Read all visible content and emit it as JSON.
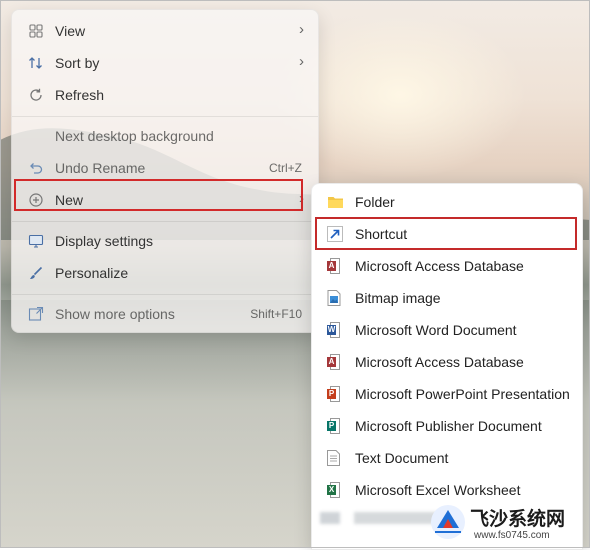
{
  "context_menu": {
    "items": [
      {
        "label": "View",
        "icon": "grid-icon",
        "submenu": true
      },
      {
        "label": "Sort by",
        "icon": "sort-icon",
        "submenu": true
      },
      {
        "label": "Refresh",
        "icon": "refresh-icon"
      },
      {
        "label": "Next desktop background",
        "icon": ""
      },
      {
        "label": "Undo Rename",
        "icon": "undo-icon",
        "shortcut": "Ctrl+Z"
      },
      {
        "label": "New",
        "icon": "plus-circle-icon",
        "submenu": true
      },
      {
        "label": "Display settings",
        "icon": "display-icon"
      },
      {
        "label": "Personalize",
        "icon": "brush-icon"
      },
      {
        "label": "Show more options",
        "icon": "more-options-icon",
        "shortcut": "Shift+F10"
      }
    ]
  },
  "new_submenu": {
    "items": [
      {
        "label": "Folder",
        "icon": "folder-icon"
      },
      {
        "label": "Shortcut",
        "icon": "shortcut-arrow-icon"
      },
      {
        "label": "Microsoft Access Database",
        "icon": "access-icon"
      },
      {
        "label": "Bitmap image",
        "icon": "bitmap-icon"
      },
      {
        "label": "Microsoft Word Document",
        "icon": "word-icon"
      },
      {
        "label": "Microsoft Access Database",
        "icon": "access-icon"
      },
      {
        "label": "Microsoft PowerPoint Presentation",
        "icon": "powerpoint-icon"
      },
      {
        "label": "Microsoft Publisher Document",
        "icon": "publisher-icon"
      },
      {
        "label": "Text Document",
        "icon": "text-document-icon"
      },
      {
        "label": "Microsoft Excel Worksheet",
        "icon": "excel-icon"
      }
    ]
  },
  "watermark": {
    "title": "飞沙系统网",
    "url": "www.fs0745.com"
  },
  "colors": {
    "highlight_border": "#d22a2a",
    "menu_bg": "#f8f6f5",
    "word": "#2b579a",
    "excel": "#217346",
    "powerpoint": "#c43e1c",
    "access": "#a4373a",
    "publisher": "#077568"
  }
}
